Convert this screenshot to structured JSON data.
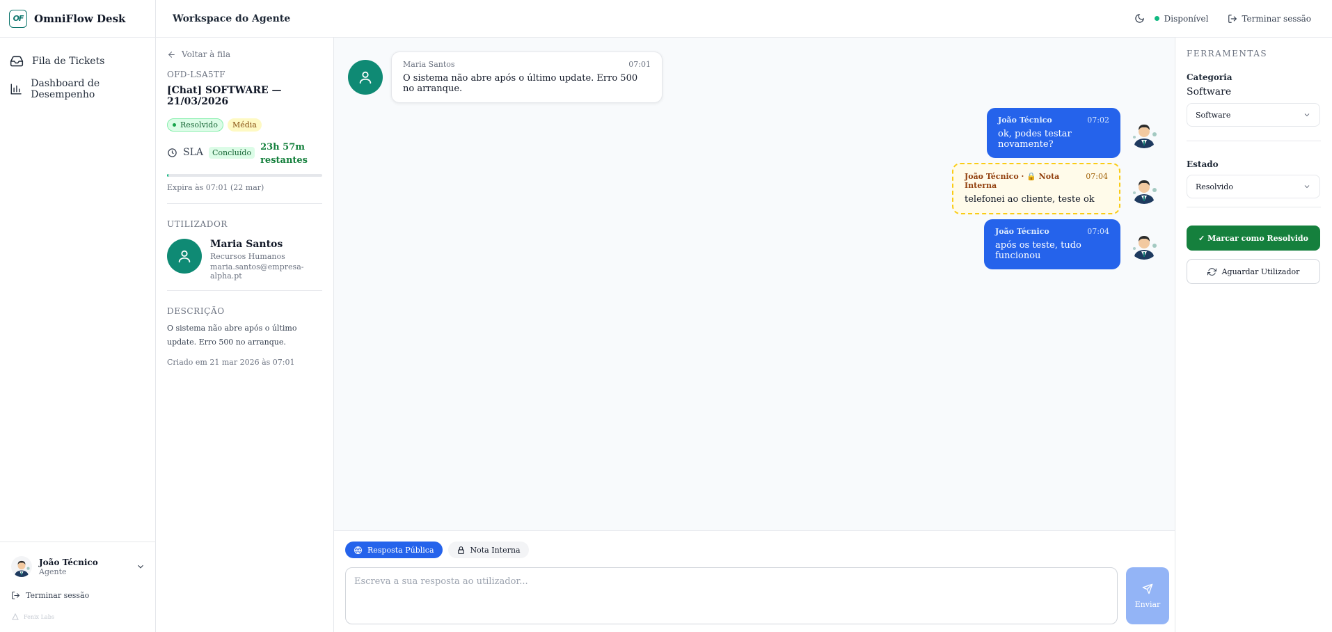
{
  "app": {
    "logo_text": "OF",
    "name": "OmniFlow Desk"
  },
  "nav": {
    "items": [
      {
        "label": "Fila de Tickets",
        "icon": "inbox-icon"
      },
      {
        "label": "Dashboard de Desempenho",
        "icon": "bar-chart-icon"
      }
    ],
    "user": {
      "name": "João Técnico",
      "role": "Agente"
    },
    "logout_label": "Terminar sessão",
    "powered_by": "Fenix Labs"
  },
  "topbar": {
    "title": "Workspace do Agente",
    "status_label": "Disponível",
    "logout_label": "Terminar sessão"
  },
  "ticket": {
    "back_label": "Voltar à fila",
    "id": "OFD-LSA5TF",
    "title": "[Chat] SOFTWARE — 21/03/2026",
    "status_badge": "Resolvido",
    "priority_badge": "Média",
    "sla_label": "SLA",
    "sla_status": "Concluído",
    "sla_remaining_line1": "23h 57m",
    "sla_remaining_line2": "restantes",
    "sla_progress": 0.01,
    "expires": "Expira às 07:01 (22 mar)",
    "user_section_label": "Utilizador",
    "user": {
      "name": "Maria Santos",
      "department": "Recursos Humanos",
      "email": "maria.santos@empresa-alpha.pt"
    },
    "description_label": "Descrição",
    "description": "O sistema não abre após o último update. Erro 500 no arranque.",
    "created": "Criado em 21 mar 2026 às 07:01"
  },
  "messages": [
    {
      "author": "Maria Santos",
      "time": "07:01",
      "text": "O sistema não abre após o último update. Erro 500 no arranque.",
      "kind": "customer"
    },
    {
      "author": "João Técnico",
      "time": "07:02",
      "text": "ok, podes testar novamente?",
      "kind": "agent"
    },
    {
      "author": "João Técnico · 🔒 Nota Interna",
      "time": "07:04",
      "text": "telefonei ao cliente, teste ok",
      "kind": "note"
    },
    {
      "author": "João Técnico",
      "time": "07:04",
      "text": "após os teste, tudo funcionou",
      "kind": "agent"
    }
  ],
  "composer": {
    "tab_public": "Resposta Pública",
    "tab_internal": "Nota Interna",
    "placeholder": "Escreva a sua resposta ao utilizador...",
    "send_label": "Enviar"
  },
  "tools": {
    "title": "Ferramentas",
    "category_label": "Categoria",
    "category_value": "Software",
    "category_select": "Software",
    "state_label": "Estado",
    "state_select": "Resolvido",
    "resolve_button": "✓ Marcar como Resolvido",
    "wait_button": "Aguardar Utilizador"
  },
  "colors": {
    "accent_blue": "#2563eb",
    "teal": "#0f8a74",
    "success": "#15803d",
    "note_border": "#facc15"
  }
}
